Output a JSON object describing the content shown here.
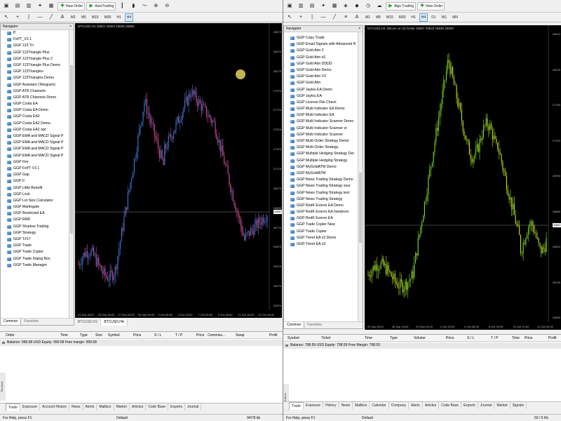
{
  "left": {
    "toolbar": {
      "new_order": "New Order",
      "algo_trading": "AutoTrading",
      "timeframes": [
        "M1",
        "M5",
        "M15",
        "M30",
        "H1",
        "H4"
      ]
    },
    "navigator": {
      "title": "Navigator",
      "items": [
        "ff",
        "FxPT_V2.1",
        "GGP 123 Tri",
        "GGP 123Triangle Plus",
        "GGP 123Triangle Plus 2",
        "GGP 123Triangle Plus Demo",
        "GGP 123Triangles",
        "GGP 123Triangles Demo",
        "GGP Assistant (Telegram)",
        "GGP ATR Channels",
        "GGP ATR Channels Demo",
        "GGP Costa EA",
        "GGP Costa EA Demo",
        "GGP Costa EA2",
        "GGP Costa EA2 Demo",
        "GGP Costa EA2 opt",
        "GGP EMA and MACD Signal P",
        "GGP EMA and MACD Signal P",
        "GGP EMA and MACD Signal P",
        "GGP EMA and MACD Signal P",
        "GGP Fire",
        "GGP FxPT V2.1",
        "GGP Gap",
        "GGP II",
        "GGP Little Benefit",
        "GGP Lock",
        "GGP Lot Size Calculator",
        "GGP Martingale",
        "GGP Restricted EA",
        "GGP RRR",
        "GGP Shadow Trading",
        "GGP Strategy",
        "GGP T#17",
        "GGP Trade",
        "GGP Trade Copier",
        "GGP Trade Dialog Box",
        "GGP Trade Manager"
      ],
      "tabs": [
        "Common",
        "Favorites"
      ]
    },
    "chart": {
      "title": "BTCUSD,H4  26901 26923 26838 26850",
      "price_ticks": [
        "28570",
        "28370",
        "28170",
        "27970",
        "27770",
        "27570",
        "27370",
        "27170",
        "26970",
        "26890",
        "26770",
        "26570",
        "26370",
        "26170",
        "25970"
      ],
      "current_price": "26850",
      "date_ticks": [
        "21 Sep 2023",
        "25 Sep 08:00",
        "27 Sep 16:00",
        "30 Sep 00:00",
        "2 Oct 08:00",
        "4 Oct 16:00",
        "7 Oct 00:00",
        "9 Oct 08:00",
        "11 Oct 16:00",
        "13 Oct 16:00"
      ],
      "tabs": [
        "BTCUSD,H1",
        "BTCUSD,H4"
      ]
    },
    "terminal": {
      "columns": [
        "Order",
        "Time",
        "Type",
        "Size",
        "Symbol",
        "Price",
        "S / L",
        "T / P",
        "Price",
        "Commiss...",
        "Swap",
        "Profit"
      ],
      "balance": "Balance: 999.58 USD  Equity: 999.58  Free margin: 999.58",
      "tabs": [
        "Trade",
        "Exposure",
        "Account History",
        "News",
        "Alerts",
        "Mailbox",
        "Market",
        "Articles",
        "Code Base",
        "Experts",
        "Journal"
      ],
      "side_label": "Terminal"
    },
    "status": {
      "help": "For Help, press F1",
      "profile": "Default",
      "traffic": "947/5 kb"
    }
  },
  "right": {
    "toolbar": {
      "algo_trading": "Algo Trading",
      "new_order": "New Order",
      "timeframes": [
        "M1",
        "M5",
        "M15",
        "M30",
        "H1",
        "H4",
        "D1",
        "W1",
        "MN"
      ]
    },
    "navigator": {
      "title": "Navigator",
      "items": [
        "GGP Copy Trade",
        "GGP Email Signals with Advanced R",
        "GGP Gold Atm 2",
        "GGP Gold Atm d1",
        "GGP Gold Atm DDDD",
        "GGP Gold Atm Demo",
        "GGP Gold Atm V3",
        "GGP Gold Atm",
        "GGP Jaykiu EA Demo",
        "GGP Jaykiu EA",
        "GGP License File Check",
        "GGP Multi Indicator EA Demo",
        "GGP Multi Indicator EA",
        "GGP Multi Indicator Scanner Demo",
        "GGP Multi Indicator Scanner sr",
        "GGP Multi Indicator Scanner",
        "GGP Multi Order Strategy Demo",
        "GGP Multi Order Strategy",
        "GGP Multiple Hedging Strategy Der",
        "GGP Multiple Hedging Strategy",
        "GGP MyGoldATM Demo",
        "GGP MyGoldATM",
        "GGP News Trading Strategy Demo",
        "GGP News Trading Strategy sour",
        "GGP News Trading Strategy test",
        "GGP News Trading Strategy",
        "GGP RedK Everex EA Demo",
        "GGP RedK Everex EA handover",
        "GGP RedK Everex EA",
        "GGP Trade Copier New",
        "GGP Trade Copier",
        "GGP Trend EA v3 Demo",
        "GGP Trend EA v3"
      ],
      "tabs": [
        "Common",
        "Favorites"
      ]
    },
    "chart": {
      "title": "BTCUSD,H4:  Bitcoin vs US Dollar  26897 26933 26835 26850",
      "price_ticks": [
        "28510",
        "28120",
        "27750",
        "27370",
        "26990",
        "26850",
        "26610",
        "26230",
        "25850"
      ],
      "current_price": "26850",
      "date_ticks": [
        "23 Sep 2023",
        "26 Sep 16:00",
        "29 Sep 04:00",
        "2 Oct 20:00",
        "5 Oct 08:00",
        "8 Oct 00:00",
        "10 Oct 12:00",
        "12 Oct 00:00"
      ]
    },
    "terminal": {
      "columns": [
        "Symbol",
        "Ticket",
        "Time",
        "Type",
        "Volume",
        "Price",
        "S / L",
        "T / P",
        "Time",
        "Price",
        "Profit"
      ],
      "balance": "Balance: 798.59 USD  Equity: 798.59  Free Margin: 798.59",
      "tabs": [
        "Trade",
        "Exposure",
        "History",
        "News",
        "Mailbox",
        "Calendar",
        "Company",
        "Alerts",
        "Articles",
        "Code Base",
        "Experts",
        "Journal"
      ],
      "extra": [
        "Market",
        "Signals"
      ],
      "side_label": "Toolbox"
    },
    "status": {
      "help": "For Help, press F1",
      "profile": "Default",
      "traffic": "50 / 5 Kb"
    }
  },
  "colors": {
    "bull_left": "#3b7fe0",
    "bear_left": "#d94f9a",
    "bull_right": "#7ee02c",
    "bear_right": "#c9e022"
  }
}
